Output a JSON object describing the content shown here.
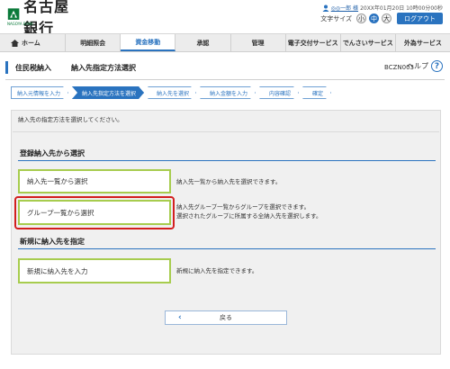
{
  "header": {
    "bank_name": "名古屋銀行",
    "logo_sub": "NAGOYA BANK",
    "user_name": "◎◎一郎 様",
    "datetime": "20XX年01月20日 10時00分00秒",
    "font_size_label": "文字サイズ",
    "font_sizes": [
      "小",
      "中",
      "大"
    ],
    "font_size_selected": "中",
    "logout_label": "ログアウト"
  },
  "nav": {
    "items": [
      "ホーム",
      "明細照会",
      "資金移動",
      "承認",
      "管理",
      "電子交付サービス",
      "でんさいサービス",
      "外為サービス"
    ],
    "active": "資金移動"
  },
  "page": {
    "category": "住民税納入",
    "title": "納入先指定方法選択",
    "screen_id": "BCZN003",
    "help_label": "ヘルプ"
  },
  "steps": {
    "items": [
      "納入元情報を入力",
      "納入先指定方法を選択",
      "納入先を選択",
      "納入金額を入力",
      "内容確認",
      "確定"
    ],
    "active_index": 1
  },
  "main": {
    "intro": "納入先の指定方法を選択してください。",
    "section1_title": "登録納入先から選択",
    "option1_label": "納入先一覧から選択",
    "option1_desc": "納入先一覧から納入先を選択できます。",
    "option2_label": "グループ一覧から選択",
    "option2_desc_1": "納入先グループ一覧からグループを選択できます。",
    "option2_desc_2": "選択されたグループに所属する全納入先を選択します。",
    "section2_title": "新規に納入先を指定",
    "option3_label": "新規に納入先を入力",
    "option3_desc": "新規に納入先を指定できます。",
    "back_label": "戻る"
  },
  "colors": {
    "accent": "#2a73bf",
    "option_border": "#a7cc4e",
    "highlight": "#d31f1f",
    "logo_green": "#0a7a3a"
  }
}
